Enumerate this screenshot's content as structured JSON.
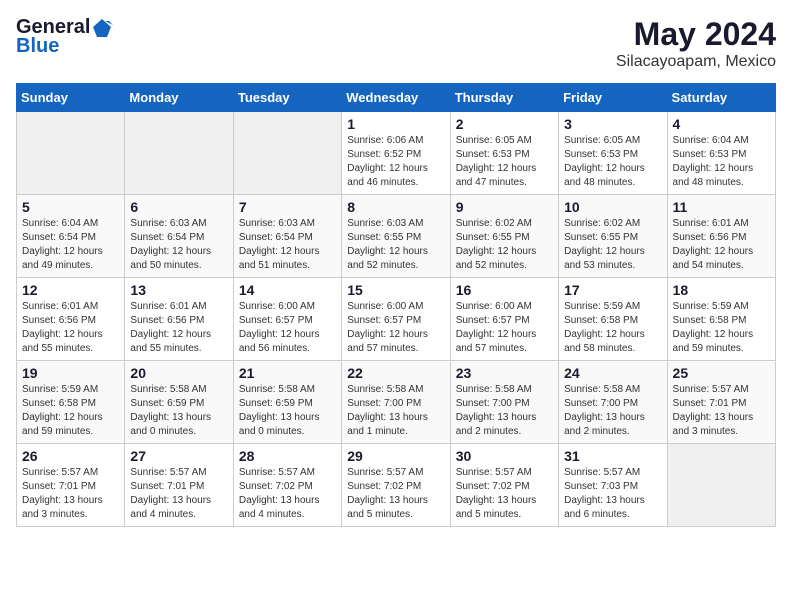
{
  "header": {
    "logo_general": "General",
    "logo_blue": "Blue",
    "title": "May 2024",
    "subtitle": "Silacayoapam, Mexico"
  },
  "calendar": {
    "days_of_week": [
      "Sunday",
      "Monday",
      "Tuesday",
      "Wednesday",
      "Thursday",
      "Friday",
      "Saturday"
    ],
    "weeks": [
      [
        {
          "day": "",
          "info": ""
        },
        {
          "day": "",
          "info": ""
        },
        {
          "day": "",
          "info": ""
        },
        {
          "day": "1",
          "info": "Sunrise: 6:06 AM\nSunset: 6:52 PM\nDaylight: 12 hours\nand 46 minutes."
        },
        {
          "day": "2",
          "info": "Sunrise: 6:05 AM\nSunset: 6:53 PM\nDaylight: 12 hours\nand 47 minutes."
        },
        {
          "day": "3",
          "info": "Sunrise: 6:05 AM\nSunset: 6:53 PM\nDaylight: 12 hours\nand 48 minutes."
        },
        {
          "day": "4",
          "info": "Sunrise: 6:04 AM\nSunset: 6:53 PM\nDaylight: 12 hours\nand 48 minutes."
        }
      ],
      [
        {
          "day": "5",
          "info": "Sunrise: 6:04 AM\nSunset: 6:54 PM\nDaylight: 12 hours\nand 49 minutes."
        },
        {
          "day": "6",
          "info": "Sunrise: 6:03 AM\nSunset: 6:54 PM\nDaylight: 12 hours\nand 50 minutes."
        },
        {
          "day": "7",
          "info": "Sunrise: 6:03 AM\nSunset: 6:54 PM\nDaylight: 12 hours\nand 51 minutes."
        },
        {
          "day": "8",
          "info": "Sunrise: 6:03 AM\nSunset: 6:55 PM\nDaylight: 12 hours\nand 52 minutes."
        },
        {
          "day": "9",
          "info": "Sunrise: 6:02 AM\nSunset: 6:55 PM\nDaylight: 12 hours\nand 52 minutes."
        },
        {
          "day": "10",
          "info": "Sunrise: 6:02 AM\nSunset: 6:55 PM\nDaylight: 12 hours\nand 53 minutes."
        },
        {
          "day": "11",
          "info": "Sunrise: 6:01 AM\nSunset: 6:56 PM\nDaylight: 12 hours\nand 54 minutes."
        }
      ],
      [
        {
          "day": "12",
          "info": "Sunrise: 6:01 AM\nSunset: 6:56 PM\nDaylight: 12 hours\nand 55 minutes."
        },
        {
          "day": "13",
          "info": "Sunrise: 6:01 AM\nSunset: 6:56 PM\nDaylight: 12 hours\nand 55 minutes."
        },
        {
          "day": "14",
          "info": "Sunrise: 6:00 AM\nSunset: 6:57 PM\nDaylight: 12 hours\nand 56 minutes."
        },
        {
          "day": "15",
          "info": "Sunrise: 6:00 AM\nSunset: 6:57 PM\nDaylight: 12 hours\nand 57 minutes."
        },
        {
          "day": "16",
          "info": "Sunrise: 6:00 AM\nSunset: 6:57 PM\nDaylight: 12 hours\nand 57 minutes."
        },
        {
          "day": "17",
          "info": "Sunrise: 5:59 AM\nSunset: 6:58 PM\nDaylight: 12 hours\nand 58 minutes."
        },
        {
          "day": "18",
          "info": "Sunrise: 5:59 AM\nSunset: 6:58 PM\nDaylight: 12 hours\nand 59 minutes."
        }
      ],
      [
        {
          "day": "19",
          "info": "Sunrise: 5:59 AM\nSunset: 6:58 PM\nDaylight: 12 hours\nand 59 minutes."
        },
        {
          "day": "20",
          "info": "Sunrise: 5:58 AM\nSunset: 6:59 PM\nDaylight: 13 hours\nand 0 minutes."
        },
        {
          "day": "21",
          "info": "Sunrise: 5:58 AM\nSunset: 6:59 PM\nDaylight: 13 hours\nand 0 minutes."
        },
        {
          "day": "22",
          "info": "Sunrise: 5:58 AM\nSunset: 7:00 PM\nDaylight: 13 hours\nand 1 minute."
        },
        {
          "day": "23",
          "info": "Sunrise: 5:58 AM\nSunset: 7:00 PM\nDaylight: 13 hours\nand 2 minutes."
        },
        {
          "day": "24",
          "info": "Sunrise: 5:58 AM\nSunset: 7:00 PM\nDaylight: 13 hours\nand 2 minutes."
        },
        {
          "day": "25",
          "info": "Sunrise: 5:57 AM\nSunset: 7:01 PM\nDaylight: 13 hours\nand 3 minutes."
        }
      ],
      [
        {
          "day": "26",
          "info": "Sunrise: 5:57 AM\nSunset: 7:01 PM\nDaylight: 13 hours\nand 3 minutes."
        },
        {
          "day": "27",
          "info": "Sunrise: 5:57 AM\nSunset: 7:01 PM\nDaylight: 13 hours\nand 4 minutes."
        },
        {
          "day": "28",
          "info": "Sunrise: 5:57 AM\nSunset: 7:02 PM\nDaylight: 13 hours\nand 4 minutes."
        },
        {
          "day": "29",
          "info": "Sunrise: 5:57 AM\nSunset: 7:02 PM\nDaylight: 13 hours\nand 5 minutes."
        },
        {
          "day": "30",
          "info": "Sunrise: 5:57 AM\nSunset: 7:02 PM\nDaylight: 13 hours\nand 5 minutes."
        },
        {
          "day": "31",
          "info": "Sunrise: 5:57 AM\nSunset: 7:03 PM\nDaylight: 13 hours\nand 6 minutes."
        },
        {
          "day": "",
          "info": ""
        }
      ]
    ]
  }
}
